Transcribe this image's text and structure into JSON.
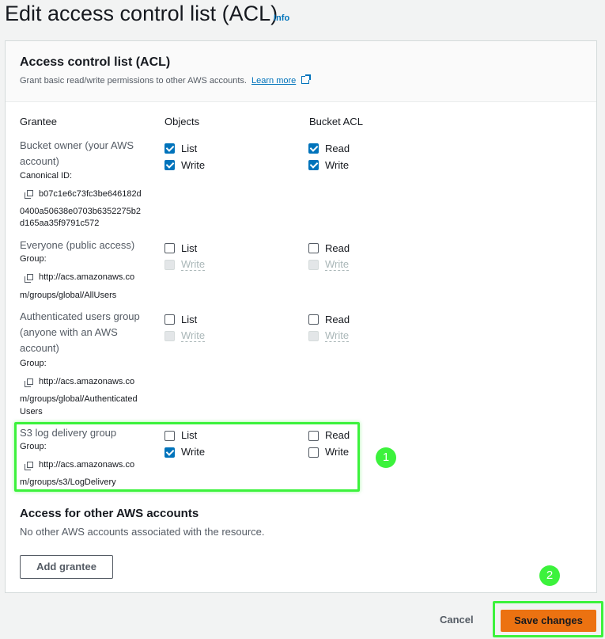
{
  "page": {
    "title": "Edit access control list (ACL)",
    "info": "Info"
  },
  "panel": {
    "title": "Access control list (ACL)",
    "description": "Grant basic read/write permissions to other AWS accounts.",
    "learn_more": "Learn more"
  },
  "columns": {
    "grantee": "Grantee",
    "objects": "Objects",
    "bucket_acl": "Bucket ACL"
  },
  "grantees": [
    {
      "name": "Bucket owner (your AWS account)",
      "label": "Canonical ID:",
      "id_lines": [
        "b07c1e6c73fc3be646182d",
        "0400a50638e0703b6352275b2",
        "d165aa35f9791c572"
      ],
      "objects_list": "List",
      "objects_list_checked": true,
      "objects_write": "Write",
      "objects_write_checked": true,
      "acl_read": "Read",
      "acl_read_checked": true,
      "acl_write": "Write",
      "acl_write_checked": true
    },
    {
      "name": "Everyone (public access)",
      "label": "Group:",
      "id_lines": [
        "http://acs.amazonaws.co",
        "m/groups/global/AllUsers"
      ],
      "objects_list": "List",
      "objects_list_checked": false,
      "objects_write": "Write",
      "objects_write_disabled": true,
      "acl_read": "Read",
      "acl_read_checked": false,
      "acl_write": "Write",
      "acl_write_disabled": true
    },
    {
      "name": "Authenticated users group (anyone with an AWS account)",
      "label": "Group:",
      "id_lines": [
        "http://acs.amazonaws.co",
        "m/groups/global/Authenticated",
        "Users"
      ],
      "objects_list": "List",
      "objects_list_checked": false,
      "objects_write": "Write",
      "objects_write_disabled": true,
      "acl_read": "Read",
      "acl_read_checked": false,
      "acl_write": "Write",
      "acl_write_disabled": true
    },
    {
      "name": "S3 log delivery group",
      "label": "Group:",
      "id_lines": [
        "http://acs.amazonaws.co",
        "m/groups/s3/LogDelivery"
      ],
      "objects_list": "List",
      "objects_list_checked": false,
      "objects_write": "Write",
      "objects_write_checked": true,
      "acl_read": "Read",
      "acl_read_checked": false,
      "acl_write": "Write",
      "acl_write_checked": false
    }
  ],
  "other_accounts": {
    "title": "Access for other AWS accounts",
    "description": "No other AWS accounts associated with the resource.",
    "add_button": "Add grantee"
  },
  "footer": {
    "cancel": "Cancel",
    "save": "Save changes"
  },
  "annotations": {
    "badge1": "1",
    "badge2": "2",
    "highlight_color": "#3cf23c"
  },
  "colors": {
    "accent": "#0073bb",
    "primary_button": "#ec7211",
    "background": "#f2f3f3"
  },
  "icons": [
    "copy-icon",
    "external-link-icon",
    "checkbox-icon"
  ]
}
